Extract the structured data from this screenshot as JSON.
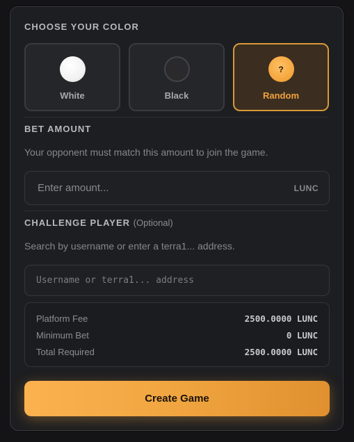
{
  "color_section": {
    "title": "CHOOSE YOUR COLOR",
    "options": [
      {
        "label": "White",
        "selected": false
      },
      {
        "label": "Black",
        "selected": false
      },
      {
        "label": "Random",
        "glyph": "?",
        "selected": true
      }
    ]
  },
  "bet_section": {
    "title": "BET AMOUNT",
    "description": "Your opponent must match this amount to join the game.",
    "placeholder": "Enter amount...",
    "value": "",
    "unit": "LUNC"
  },
  "challenge_section": {
    "title": "CHALLENGE PLAYER",
    "optional": "(Optional)",
    "description": "Search by username or enter a terra1... address.",
    "placeholder": "Username or terra1... address",
    "value": ""
  },
  "fees": [
    {
      "label": "Platform Fee",
      "value": "2500.0000 LUNC"
    },
    {
      "label": "Minimum Bet",
      "value": "0 LUNC"
    },
    {
      "label": "Total Required",
      "value": "2500.0000 LUNC"
    }
  ],
  "actions": {
    "create_label": "Create Game"
  },
  "colors": {
    "accent": "#f4a43a",
    "panel": "#1d1e21",
    "background": "#141416"
  }
}
